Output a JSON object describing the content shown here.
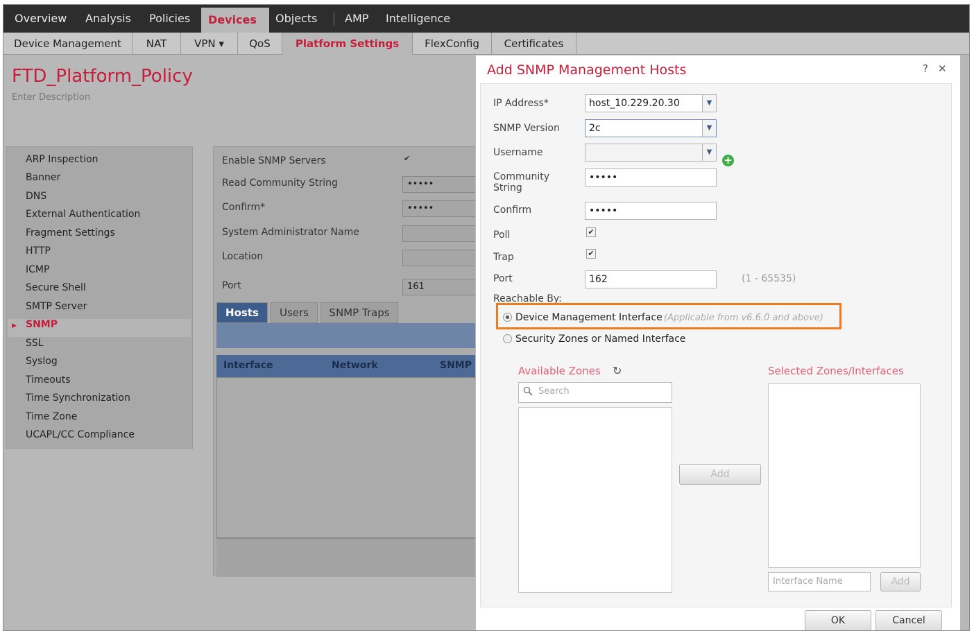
{
  "topnav": {
    "items": [
      "Overview",
      "Analysis",
      "Policies",
      "Devices",
      "Objects",
      "AMP",
      "Intelligence"
    ],
    "active": "Devices"
  },
  "subnav": {
    "tabs": [
      "Device Management",
      "NAT",
      "VPN ▾",
      "QoS",
      "Platform Settings",
      "FlexConfig",
      "Certificates"
    ],
    "active": "Platform Settings"
  },
  "policy": {
    "title": "FTD_Platform_Policy",
    "description": "Enter Description"
  },
  "leftnav": {
    "items": [
      "ARP Inspection",
      "Banner",
      "DNS",
      "External Authentication",
      "Fragment Settings",
      "HTTP",
      "ICMP",
      "Secure Shell",
      "SMTP Server",
      "SNMP",
      "SSL",
      "Syslog",
      "Timeouts",
      "Time Synchronization",
      "Time Zone",
      "UCAPL/CC Compliance"
    ],
    "active": "SNMP"
  },
  "snmp_form": {
    "enable_label": "Enable SNMP Servers",
    "enable_checked": true,
    "read_community_label": "Read Community String",
    "read_community_value": "•••••",
    "confirm_label": "Confirm*",
    "confirm_value": "•••••",
    "sysadmin_label": "System Administrator Name",
    "location_label": "Location",
    "port_label": "Port",
    "port_value": "161",
    "tabs": [
      "Hosts",
      "Users",
      "SNMP Traps"
    ],
    "active_tab": "Hosts",
    "table_headers": [
      "Interface",
      "Network",
      "SNMP '"
    ]
  },
  "modal": {
    "title": "Add SNMP Management Hosts",
    "help_icon": "?",
    "close_icon": "✕",
    "ip_label": "IP Address*",
    "ip_value": "host_10.229.20.30",
    "version_label": "SNMP Version",
    "version_value": "2c",
    "username_label": "Username",
    "username_value": "",
    "community_label_1": "Community",
    "community_label_2": "String",
    "community_value": "•••••",
    "confirm_label": "Confirm",
    "confirm_value": "•••••",
    "poll_label": "Poll",
    "poll_checked": true,
    "trap_label": "Trap",
    "trap_checked": true,
    "port_label": "Port",
    "port_value": "162",
    "port_range": "(1 - 65535)",
    "reachable_label": "Reachable By:",
    "option_dmi": "Device Management Interface",
    "option_dmi_note": "(Applicable from v6.6.0 and above)",
    "option_zones": "Security Zones or Named Interface",
    "selected_option": "dmi",
    "available_zones_label": "Available Zones",
    "search_placeholder": "Search",
    "add_button": "Add",
    "selected_zones_label": "Selected Zones/Interfaces",
    "interface_name_placeholder": "Interface Name",
    "add_small_button": "Add",
    "ok_button": "OK",
    "cancel_button": "Cancel"
  },
  "colors": {
    "brand_red": "#c41e3a",
    "highlight_orange": "#f07a1d",
    "add_green": "#3fae49",
    "tab_blue": "#3c5d8c"
  }
}
